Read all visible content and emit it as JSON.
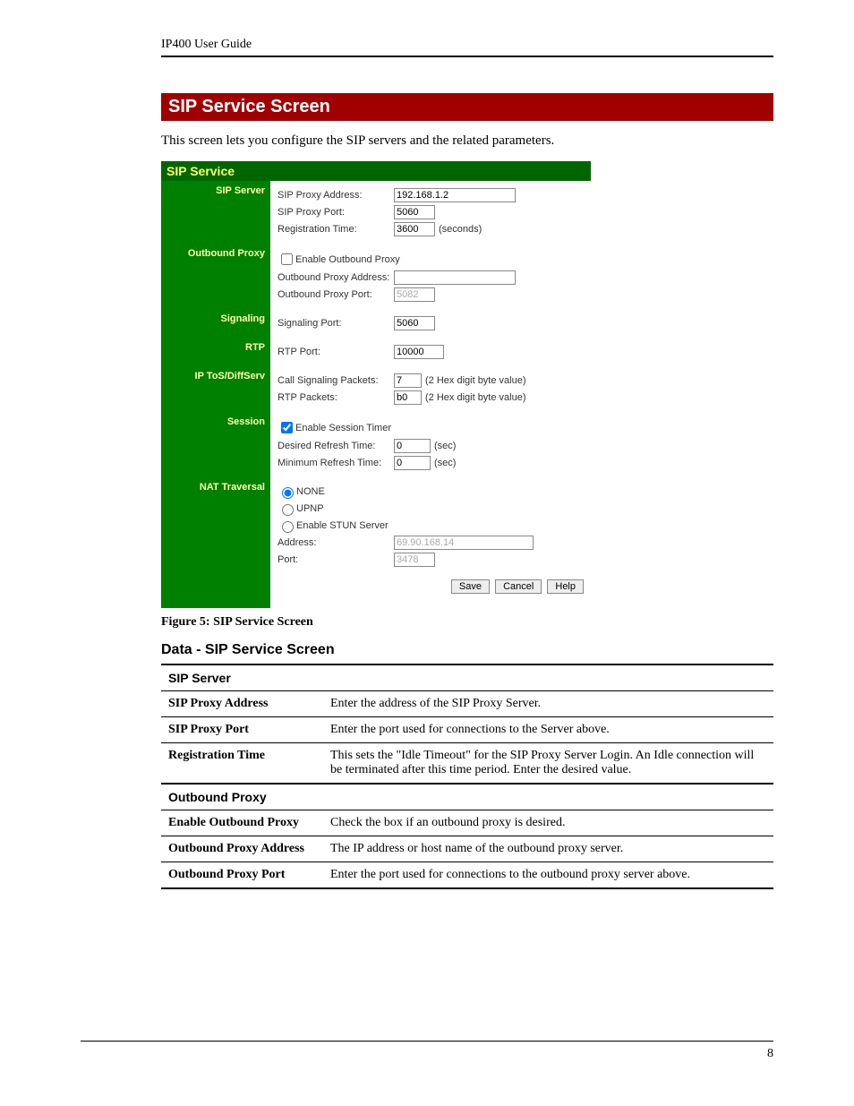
{
  "header": {
    "doc_title": "IP400 User Guide"
  },
  "section": {
    "bar_title": "SIP Service Screen",
    "intro": "This screen lets you configure the SIP servers and the related parameters."
  },
  "panel": {
    "title": "SIP Service",
    "sections": {
      "sip_server": {
        "label": "SIP Server",
        "proxy_address_label": "SIP Proxy Address:",
        "proxy_address_value": "192.168.1.2",
        "proxy_port_label": "SIP Proxy Port:",
        "proxy_port_value": "5060",
        "reg_time_label": "Registration Time:",
        "reg_time_value": "3600",
        "reg_time_suffix": "(seconds)"
      },
      "outbound_proxy": {
        "label": "Outbound Proxy",
        "enable_label": "Enable Outbound Proxy",
        "address_label": "Outbound Proxy Address:",
        "address_value": "",
        "port_label": "Outbound Proxy Port:",
        "port_value": "5082"
      },
      "signaling": {
        "label": "Signaling",
        "port_label": "Signaling Port:",
        "port_value": "5060"
      },
      "rtp": {
        "label": "RTP",
        "port_label": "RTP Port:",
        "port_value": "10000"
      },
      "tos": {
        "label": "IP ToS/DiffServ",
        "call_label": "Call Signaling Packets:",
        "call_value": "7",
        "rtp_label": "RTP Packets:",
        "rtp_value": "b0",
        "suffix": "(2 Hex digit byte value)"
      },
      "session": {
        "label": "Session",
        "enable_label": "Enable Session Timer",
        "desired_label": "Desired Refresh Time:",
        "desired_value": "0",
        "min_label": "Minimum Refresh Time:",
        "min_value": "0",
        "suffix": "(sec)"
      },
      "nat": {
        "label": "NAT Traversal",
        "none_label": "NONE",
        "upnp_label": "UPNP",
        "stun_label": "Enable STUN Server",
        "address_label": "Address:",
        "address_value": "69.90.168.14",
        "port_label": "Port:",
        "port_value": "3478"
      }
    },
    "buttons": {
      "save": "Save",
      "cancel": "Cancel",
      "help": "Help"
    }
  },
  "caption": "Figure 5: SIP Service Screen",
  "data_heading": "Data - SIP Service Screen",
  "datatable": {
    "sip_server_header": "SIP Server",
    "rows1": [
      {
        "k": "SIP Proxy Address",
        "v": "Enter the address of the SIP Proxy Server."
      },
      {
        "k": "SIP Proxy Port",
        "v": "Enter the port used for connections to the Server above."
      },
      {
        "k": "Registration Time",
        "v": "This sets the \"Idle Timeout\" for the SIP Proxy Server Login. An Idle connection will be terminated after this time period. Enter the desired value."
      }
    ],
    "outbound_proxy_header": "Outbound Proxy",
    "rows2": [
      {
        "k": "Enable Outbound Proxy",
        "v": "Check the box if an outbound proxy is desired."
      },
      {
        "k": "Outbound Proxy Address",
        "v": "The IP address or host name of the outbound proxy server."
      },
      {
        "k": "Outbound Proxy Port",
        "v": "Enter the port used for connections to the outbound proxy server above."
      }
    ]
  },
  "page_number": "8"
}
